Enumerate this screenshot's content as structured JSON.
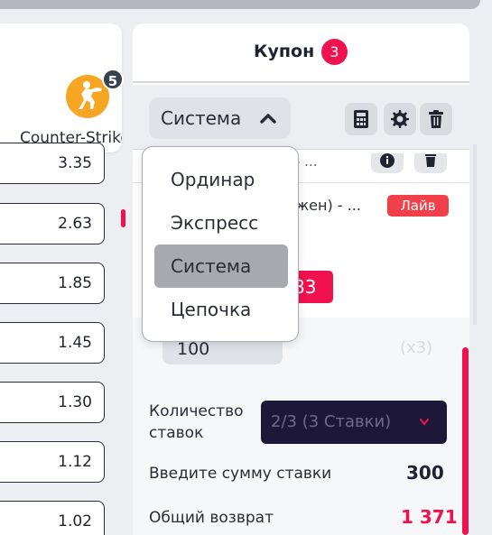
{
  "game": {
    "name": "Counter-Strike",
    "badge": "5"
  },
  "odds": [
    "3.35",
    "2.63",
    "1.85",
    "1.45",
    "1.30",
    "1.12",
    "1.02"
  ],
  "coupon": {
    "title": "Купон",
    "count": "3",
    "type_select": {
      "value": "Система"
    },
    "bet": {
      "line1": "- ...",
      "team": "ь (жен) - ...",
      "live_badge": "Лайв",
      "odd": "83"
    },
    "stake_input": "100",
    "multiplier": "(x3)",
    "count_label": "Количество ставок",
    "count_select": "2/3 (3 Ставки)",
    "stake_label": "Введите сумму ставки",
    "stake_value": "300",
    "return_label": "Общий возврат",
    "return_value": "1 371"
  },
  "dropdown": {
    "items": [
      "Ординар",
      "Экспресс",
      "Система",
      "Цепочка"
    ],
    "selected": "Система"
  },
  "colors": {
    "accent": "#f0124f",
    "dark": "#1e1838",
    "live": "#f2404a"
  }
}
